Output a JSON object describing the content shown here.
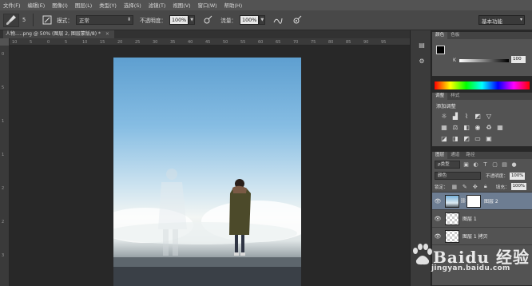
{
  "menu": [
    "文件(F)",
    "编辑(E)",
    "图像(I)",
    "图层(L)",
    "类型(Y)",
    "选择(S)",
    "滤镜(T)",
    "视图(V)",
    "窗口(W)",
    "帮助(H)"
  ],
  "options": {
    "brush_size": "5",
    "mode_label": "模式：",
    "mode_value": "正常",
    "opacity_label": "不透明度：",
    "opacity_value": "100%",
    "flow_label": "流量：",
    "flow_value": "100%",
    "workspace": "基本功能"
  },
  "document_tab": {
    "title": "人物.....png @ 50% (图层 2, 图层蒙版/8) *",
    "close": "×"
  },
  "ruler_h_ticks": [
    "10",
    "5",
    "0",
    "5",
    "10",
    "15",
    "20",
    "25",
    "30",
    "35",
    "40",
    "45",
    "50",
    "55",
    "60",
    "65",
    "70",
    "75",
    "80",
    "85",
    "90",
    "95"
  ],
  "ruler_v_ticks": [
    "0",
    "5",
    "1",
    "1",
    "2",
    "2",
    "3"
  ],
  "color_panel": {
    "tabs": [
      "颜色",
      "色板"
    ],
    "k_label": "K",
    "k_value": "100"
  },
  "adjustments_panel": {
    "tabs": [
      "调整",
      "样式"
    ],
    "title": "添加调整"
  },
  "layers_panel": {
    "tabs": [
      "图层",
      "通道",
      "路径"
    ],
    "filter_kind": "ρ类型",
    "blend_mode": "颜色",
    "opacity_label": "不透明度：",
    "opacity_value": "100%",
    "lock_label": "锁定：",
    "fill_label": "填充：",
    "fill_value": "100%",
    "layers": [
      {
        "name": "图层 2",
        "selected": true
      },
      {
        "name": "图层 1",
        "selected": false
      },
      {
        "name": "图层 1 拷贝",
        "selected": false
      }
    ]
  },
  "watermark": {
    "brand": "Baidu 经验",
    "url": "jingyan.baidu.com"
  },
  "colors": {
    "menubar": "#535353",
    "panel": "#535353",
    "canvas_bg": "#282828",
    "selected_layer": "#6d7d92"
  }
}
